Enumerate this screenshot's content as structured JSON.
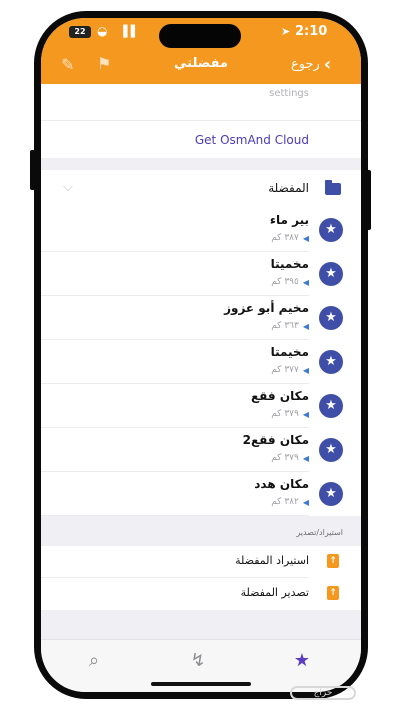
{
  "status_bar": {
    "battery": "22",
    "time": "2:10"
  },
  "nav": {
    "back_label": "رجوع",
    "title": "مفضلتي"
  },
  "icons": {
    "edit": "pencil-icon",
    "sign": "signpost-icon",
    "back": "chevron-left-icon",
    "folder": "folder-icon",
    "favorite": "star-icon",
    "direction": "direction-arrow-icon",
    "share": "share-icon"
  },
  "settings_label": "settings",
  "cloud_label": "Get OsmAnd Cloud",
  "folder": {
    "name": "المفضلة"
  },
  "favorites": [
    {
      "name": "بير ماء",
      "distance": "٣٨٧ كم"
    },
    {
      "name": "مخميتا",
      "distance": "٣٩٥ كم"
    },
    {
      "name": "مخيم أبو عزوز",
      "distance": "٣٦٣ كم"
    },
    {
      "name": "مخيمتا",
      "distance": "٣٧٧ كم"
    },
    {
      "name": "مكان فقع",
      "distance": "٣٧٩ كم"
    },
    {
      "name": "مكان فقع2",
      "distance": "٣٧٩ كم"
    },
    {
      "name": "مكان هدد",
      "distance": "٣٨٢ كم"
    }
  ],
  "import_export": {
    "header": "استيراد/تصدير",
    "import_label": "استيراد المفضلة",
    "export_label": "تصدير المفضلة"
  },
  "tabs": [
    {
      "name": "search-tab"
    },
    {
      "name": "routes-tab"
    },
    {
      "name": "favorites-tab"
    }
  ],
  "colors": {
    "accent": "#f4981f",
    "favorite_badge": "#3f4fa8",
    "active_tab": "#5b3cc4"
  },
  "watermark": "حراج"
}
